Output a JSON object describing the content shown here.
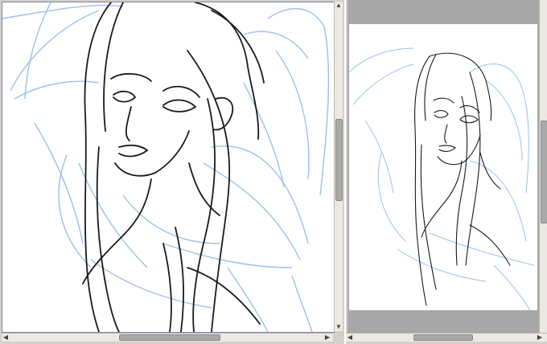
{
  "app": {
    "left_view": "sketch-canvas-zoomed",
    "right_view": "navigator-preview"
  },
  "colors": {
    "canvas_bg": "#ffffff",
    "ink_line": "#1a1a1a",
    "sketch_line": "#9fc0e6",
    "panel_bg": "#d4d0c8",
    "preview_surround": "#a8a8a8",
    "scroll_thumb": "#a9a9a9"
  },
  "icons": {
    "scroll_up": "triangle-up-icon",
    "scroll_down": "triangle-down-icon",
    "scroll_left": "triangle-left-icon",
    "scroll_right": "triangle-right-icon"
  },
  "scroll": {
    "left_vertical_position": 0.35,
    "left_horizontal_position": 0.32,
    "right_vertical_position": 0.4,
    "right_horizontal_position": 0.5
  }
}
